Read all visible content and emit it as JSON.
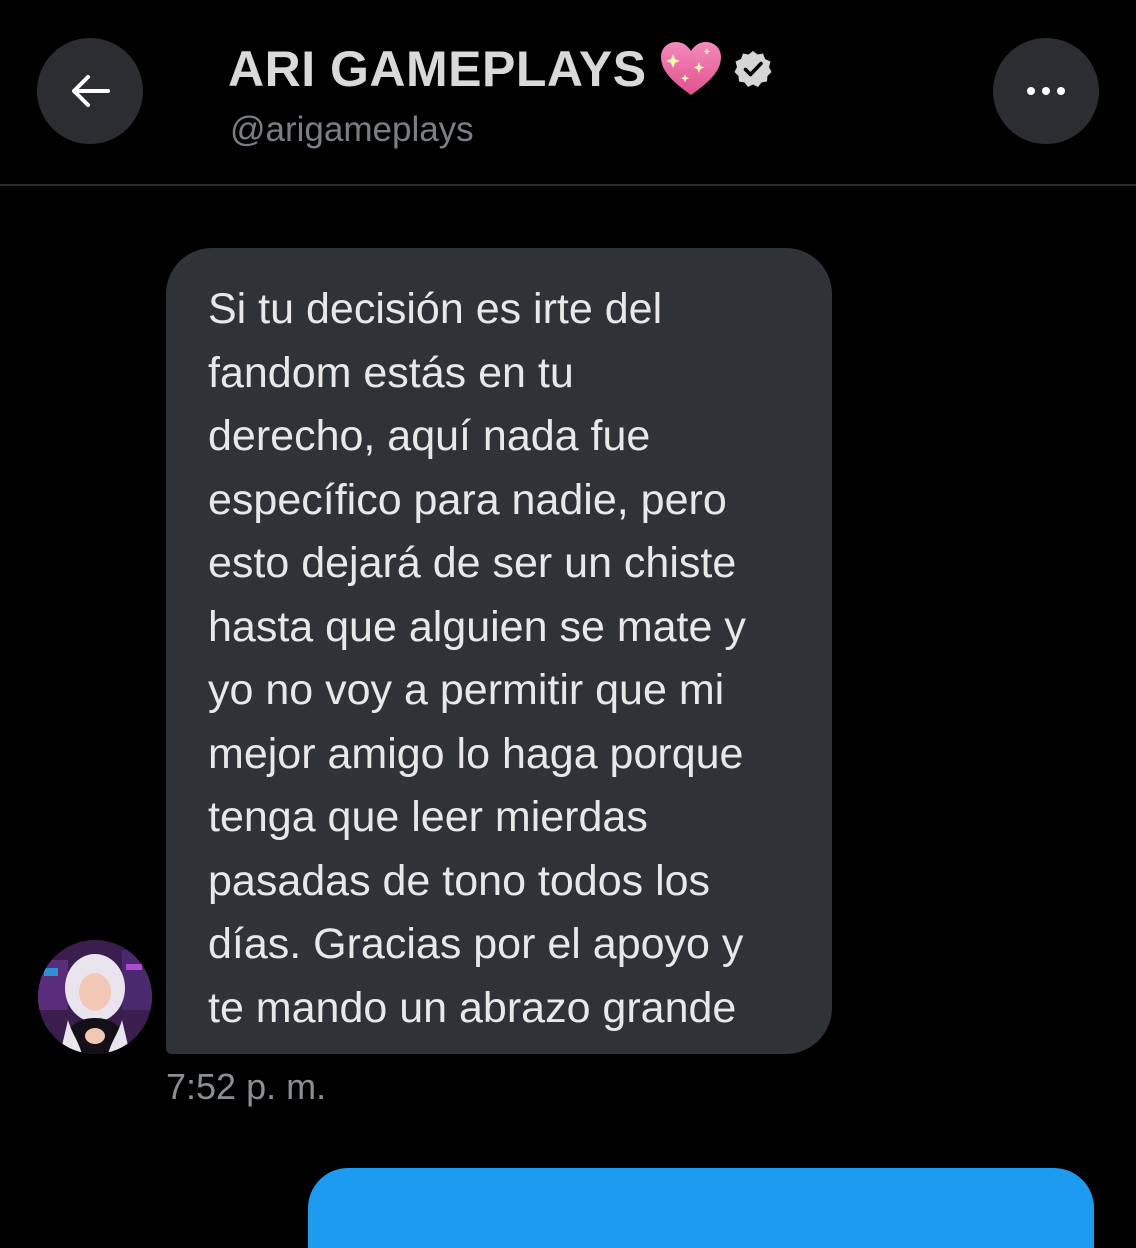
{
  "header": {
    "title": "ARI GAMEPLAYS",
    "handle": "@arigameplays",
    "back_icon": "arrow-left-icon",
    "title_emoji": "sparkling-heart-icon",
    "verified_icon": "verified-badge-icon",
    "more_icon": "more-horizontal-icon"
  },
  "conversation": {
    "message_text": "Si tu decisión es irte del\nfandom estás en tu\nderecho, aquí nada fue\nespecífico para nadie, pero\nesto dejará de ser un chiste\nhasta que alguien se mate y\nyo no voy a permitir que mi\nmejor amigo lo haga porque\ntenga que leer mierdas\npasadas de tono todos los\ndías. Gracias por el apoyo y\nte mando un abrazo grande",
    "timestamp": "7:52 p. m.",
    "avatar_icon": "user-avatar"
  },
  "colors": {
    "background": "#000000",
    "received_bubble": "#2f3337",
    "sent_bubble": "#1d9bf0",
    "heart": "#f06aa6"
  }
}
